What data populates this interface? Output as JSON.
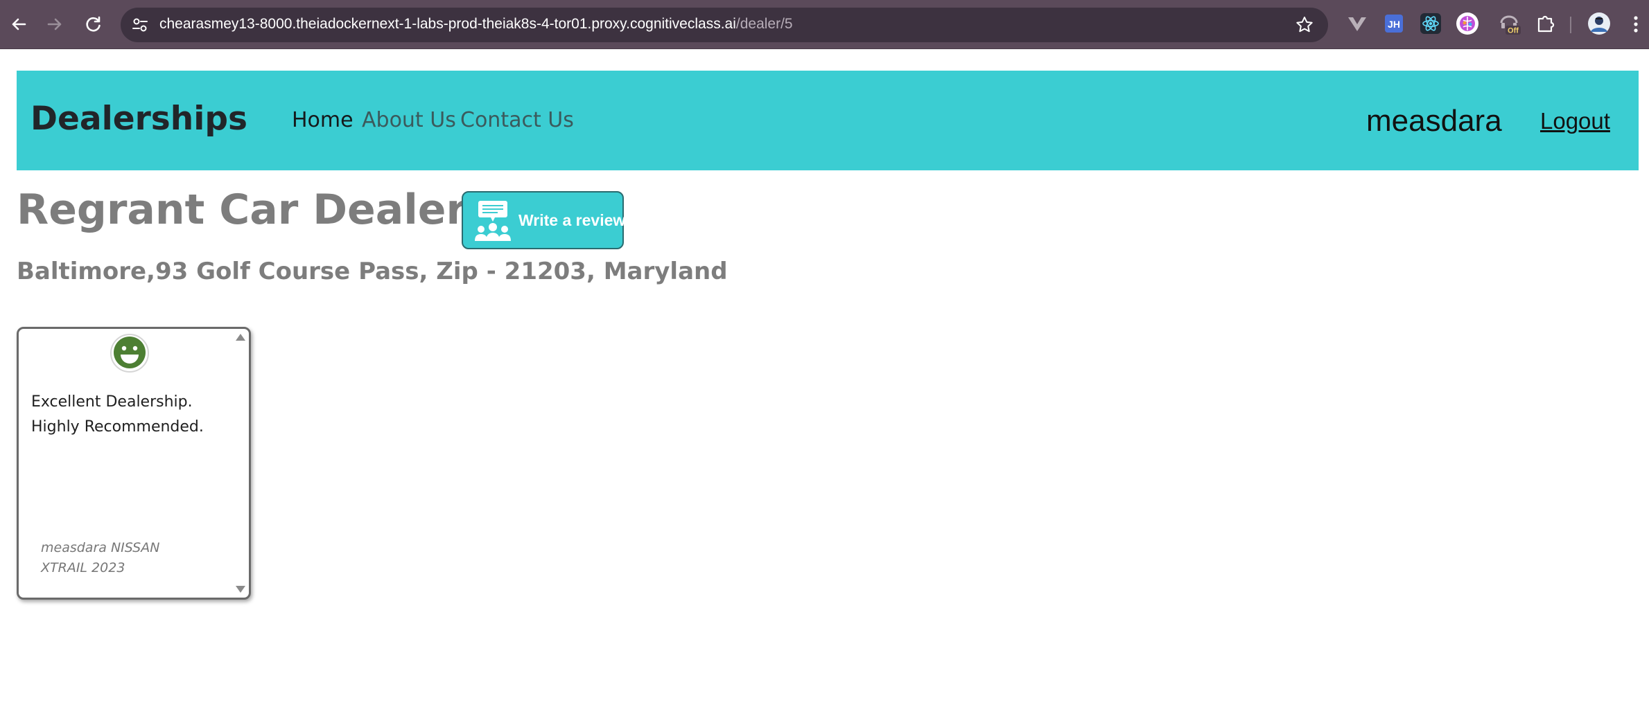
{
  "browser": {
    "url_host": "chearasmey13-8000.theiadockernext-1-labs-prod-theiak8s-4-tor01.proxy.cognitiveclass.ai",
    "url_path": "/dealer/5",
    "extensions": {
      "jh_label": "JH",
      "off_badge": "Off"
    }
  },
  "navbar": {
    "brand": "Dealerships",
    "links": [
      "Home",
      "About Us",
      "Contact Us"
    ],
    "username": "measdara",
    "logout": "Logout",
    "bg_color": "#3bcdd2"
  },
  "dealer": {
    "name": "Regrant Car Dealership",
    "address": "Baltimore,93 Golf Course Pass, Zip - 21203, Maryland",
    "write_review_label": "Write a review"
  },
  "reviews": [
    {
      "sentiment_icon": "positive-smiley-icon",
      "text": "Excellent Dealership. Highly Recommended.",
      "reviewer": "measdara NISSAN XTRAIL 2023"
    }
  ]
}
